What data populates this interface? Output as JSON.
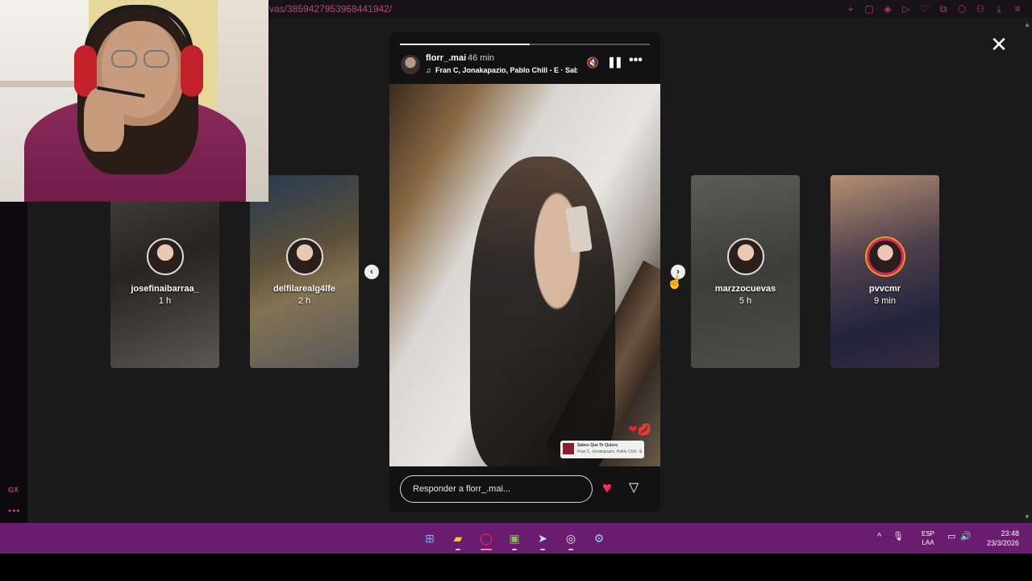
{
  "browser": {
    "url_partial": "vas/3859427953968441942/",
    "toolbar_icons": [
      "pin-icon",
      "snapshot-icon",
      "shield-icon",
      "play-icon",
      "heart-icon",
      "wallet-icon",
      "profile-icon",
      "extensions-icon",
      "download-icon",
      "menu-icon"
    ],
    "sidebar_label": "GX",
    "sidebar_more": "•••",
    "accent_color": "#c2357a"
  },
  "viewer": {
    "close_icon": "✕",
    "prev_icon": "‹",
    "next_icon": "›"
  },
  "previews": [
    {
      "username": "josefinaibarraa_",
      "time": "1 h"
    },
    {
      "username": "delfilarealg4lfe",
      "time": "2 h"
    },
    {
      "username": "marzzocuevas",
      "time": "5 h"
    },
    {
      "username": "pvvcmr",
      "time": "9 min"
    }
  ],
  "story": {
    "username": "florr_.mai",
    "time": "46 min",
    "music": "Fran C, Jonakapazio, Pablo Chill - E · Sabes Que Te Quiero",
    "music_icon": "♫",
    "mute_icon": "🔇",
    "pause_icon": "❚❚",
    "more_icon": "•••",
    "progress_done": 0.52,
    "sticker_title": "Sabes Que Te Quiero",
    "sticker_artist": "Fran C, Jonakapazio, Pablo Chill - E",
    "hearts_icon": "❤💋",
    "reply_placeholder": "Responder a florr_.mai...",
    "like_icon": "♥",
    "send_icon": "▽",
    "like_color": "#ff2d55"
  },
  "taskbar": {
    "apps": [
      "windows-start",
      "file-explorer",
      "opera-gx",
      "game-launcher",
      "steam",
      "obs-studio",
      "settings"
    ],
    "tray_expand": "^",
    "mic_icon": "🎙",
    "lang_line1": "ESP",
    "lang_line2": "LAA",
    "time": "23:48",
    "date": "23/3/2026",
    "color": "#6a1c6e"
  }
}
